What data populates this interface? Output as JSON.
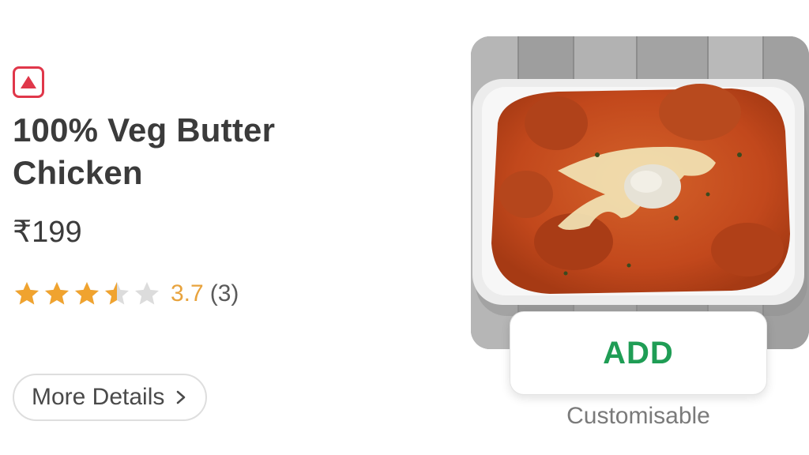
{
  "item": {
    "type_indicator_icon": "non-veg-triangle-icon",
    "name": "100% Veg Butter Chicken",
    "price": "₹199",
    "rating": {
      "value_label": "3.7",
      "count_label": "(3)",
      "stars_value": 3.7,
      "stars_max": 5
    },
    "more_details_label": "More Details",
    "more_details_icon": "chevron-right-icon",
    "add_label": "ADD",
    "customisable_label": "Customisable"
  },
  "colors": {
    "indicator": "#e0374a",
    "star_filled": "#f0a32f",
    "star_empty": "#dcdcdc",
    "rating_text": "#e8a33d",
    "add_text": "#1f9d55"
  }
}
